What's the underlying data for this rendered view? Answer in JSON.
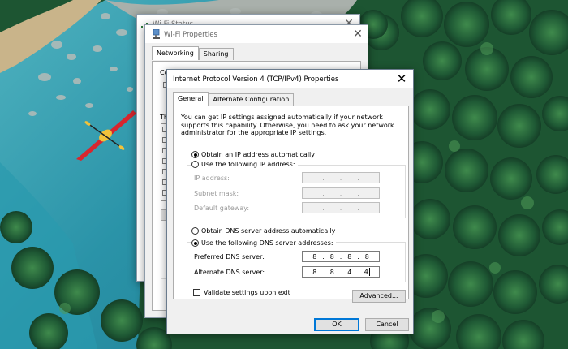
{
  "background": {
    "water_color": "#2a93a8",
    "forest_color": "#1f5a35",
    "rock_color": "#9fa7a3",
    "kayak_color": "#d8262e"
  },
  "windows": {
    "wifi_status": {
      "title": "Wi-Fi Status"
    },
    "wifi_properties": {
      "title": "Wi-Fi Properties",
      "tabs": [
        "Networking",
        "Sharing"
      ],
      "fragments": {
        "connect": "Conn",
        "this": "Th"
      }
    },
    "ipv4": {
      "title": "Internet Protocol Version 4 (TCP/IPv4) Properties",
      "close_icon": "close-icon",
      "tabs": [
        "General",
        "Alternate Configuration"
      ],
      "intro": "You can get IP settings assigned automatically if your network supports this capability. Otherwise, you need to ask your network administrator for the appropriate IP settings.",
      "ip_auto_label": "Obtain an IP address automatically",
      "ip_manual_label": "Use the following IP address:",
      "ip_auto_selected": true,
      "ip_fields": {
        "ip_address_label": "IP address:",
        "subnet_label": "Subnet mask:",
        "gateway_label": "Default gateway:"
      },
      "dns_auto_label": "Obtain DNS server address automatically",
      "dns_manual_label": "Use the following DNS server addresses:",
      "dns_manual_selected": true,
      "preferred_dns_label": "Preferred DNS server:",
      "preferred_dns": [
        "8",
        "8",
        "8",
        "8"
      ],
      "alternate_dns_label": "Alternate DNS server:",
      "alternate_dns": [
        "8",
        "8",
        "4",
        "4"
      ],
      "validate_label": "Validate settings upon exit",
      "validate_checked": false,
      "advanced_button": "Advanced...",
      "ok_button": "OK",
      "cancel_button": "Cancel"
    }
  }
}
